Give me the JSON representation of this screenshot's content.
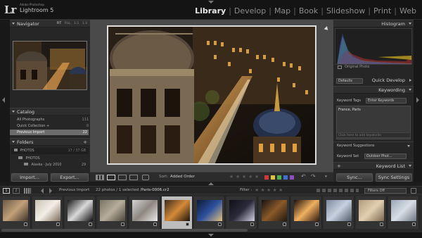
{
  "app": {
    "vendor": "Adobe Photoshop",
    "name": "Lightroom 5",
    "logo": "Lr"
  },
  "modules": [
    {
      "label": "Library",
      "active": true
    },
    {
      "label": "Develop",
      "active": false
    },
    {
      "label": "Map",
      "active": false
    },
    {
      "label": "Book",
      "active": false
    },
    {
      "label": "Slideshow",
      "active": false
    },
    {
      "label": "Print",
      "active": false
    },
    {
      "label": "Web",
      "active": false
    }
  ],
  "left_panel": {
    "navigator": {
      "title": "Navigator",
      "options": [
        "FIT",
        "FILL",
        "1:1",
        "1:3"
      ],
      "selected_option": "FIT"
    },
    "catalog": {
      "title": "Catalog",
      "items": [
        {
          "label": "All Photographs",
          "count": "111"
        },
        {
          "label": "Quick Collection +",
          "count": "0"
        },
        {
          "label": "Previous Import",
          "count": "22",
          "selected": true
        }
      ]
    },
    "folders": {
      "title": "Folders",
      "volume": {
        "label": "PHOTOS",
        "info": "17 / 37 GB"
      },
      "items": [
        {
          "label": "PHOTOS",
          "count": ""
        },
        {
          "label": "Alaska - July 2010",
          "count": "29"
        }
      ]
    },
    "import_button": "Import...",
    "export_button": "Export..."
  },
  "toolbar": {
    "sort_label": "Sort:",
    "sort_value": "Added Order",
    "label_colors": [
      "#d23a3a",
      "#e0c43a",
      "#4fb04f",
      "#3f6fd0",
      "#8a4fc0"
    ]
  },
  "right_panel": {
    "histogram": {
      "title": "Histogram",
      "caption": "Original Photo"
    },
    "quick_develop": {
      "title": "Quick Develop",
      "preset": "Defaults"
    },
    "keywording": {
      "title": "Keywording",
      "tags_label": "Keyword Tags",
      "tags_dropdown": "Enter Keywords",
      "keywords": "France, Paris",
      "placeholder": "Click here to add keywords"
    },
    "keyword_suggestions": {
      "title": "Keyword Suggestions"
    },
    "keyword_set": {
      "label": "Keyword Set",
      "value": "Outdoor Phot..."
    },
    "keyword_list": {
      "title": "Keyword List"
    },
    "sync_button": "Sync...",
    "sync_settings_button": "Sync Settings"
  },
  "filmstrip_bar": {
    "page_1": "1",
    "page_2": "2",
    "source": "Previous Import",
    "status": "22 photos / 1 selected /",
    "file": "Paris-0006.cr2",
    "filter_label": "Filter :",
    "filter_value": "Filters Off"
  },
  "filmstrip": {
    "selected_index": 5,
    "thumbs": [
      {
        "name": "thumb-1",
        "bg": "linear-gradient(135deg,#6a5a46,#c2a079,#3c3328)"
      },
      {
        "name": "thumb-2",
        "bg": "linear-gradient(135deg,#c9c2b5,#f3efe7,#7c6b58)"
      },
      {
        "name": "thumb-3",
        "bg": "linear-gradient(135deg,#1a1a1a,#d9d9d9,#111)"
      },
      {
        "name": "thumb-4",
        "bg": "linear-gradient(135deg,#7a7466,#b7ad9a,#4b463c)"
      },
      {
        "name": "thumb-5",
        "bg": "linear-gradient(135deg,#d5d5d5,#8d8780,#eaeaea)"
      },
      {
        "name": "thumb-6",
        "bg": "linear-gradient(135deg,#3a2a1a,#d58a3a,#1c140c)"
      },
      {
        "name": "thumb-7",
        "bg": "linear-gradient(135deg,#0d1b3a,#2d4f9c,#e0c080)"
      },
      {
        "name": "thumb-8",
        "bg": "linear-gradient(135deg,#101018,#2a2a3a,#d0d0e0)"
      },
      {
        "name": "thumb-9",
        "bg": "linear-gradient(135deg,#161210,#8a5a2a,#221810)"
      },
      {
        "name": "thumb-10",
        "bg": "linear-gradient(135deg,#1d0f0a,#f0b060,#301a10)"
      },
      {
        "name": "thumb-11",
        "bg": "linear-gradient(135deg,#7e8aa0,#c6d0de,#545c6c)"
      },
      {
        "name": "thumb-12",
        "bg": "linear-gradient(135deg,#b29a7a,#e2d0b0,#7a6650)"
      },
      {
        "name": "thumb-13",
        "bg": "linear-gradient(135deg,#9aa6b6,#d8dee6,#6c7684)"
      }
    ]
  }
}
